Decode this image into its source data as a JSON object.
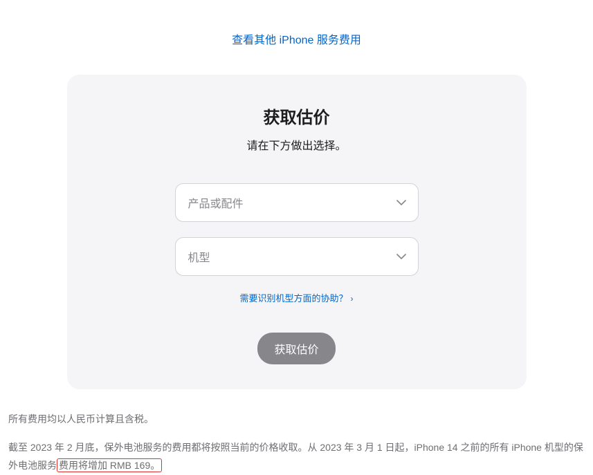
{
  "topLink": {
    "text": "查看其他 iPhone 服务费用"
  },
  "card": {
    "title": "获取估价",
    "subtitle": "请在下方做出选择。",
    "select1Placeholder": "产品或配件",
    "select2Placeholder": "机型",
    "helpLink": "需要识别机型方面的协助？",
    "buttonLabel": "获取估价"
  },
  "footer": {
    "line1": "所有费用均以人民币计算且含税。",
    "line2a": "截至 2023 年 2 月底，保外电池服务的费用都将按照当前的价格收取。从 2023 年 3 月 1 日起，iPhone 14 之前的所有 iPhone 机型的保外电池服务",
    "line2b": "费用将增加 RMB 169。"
  }
}
